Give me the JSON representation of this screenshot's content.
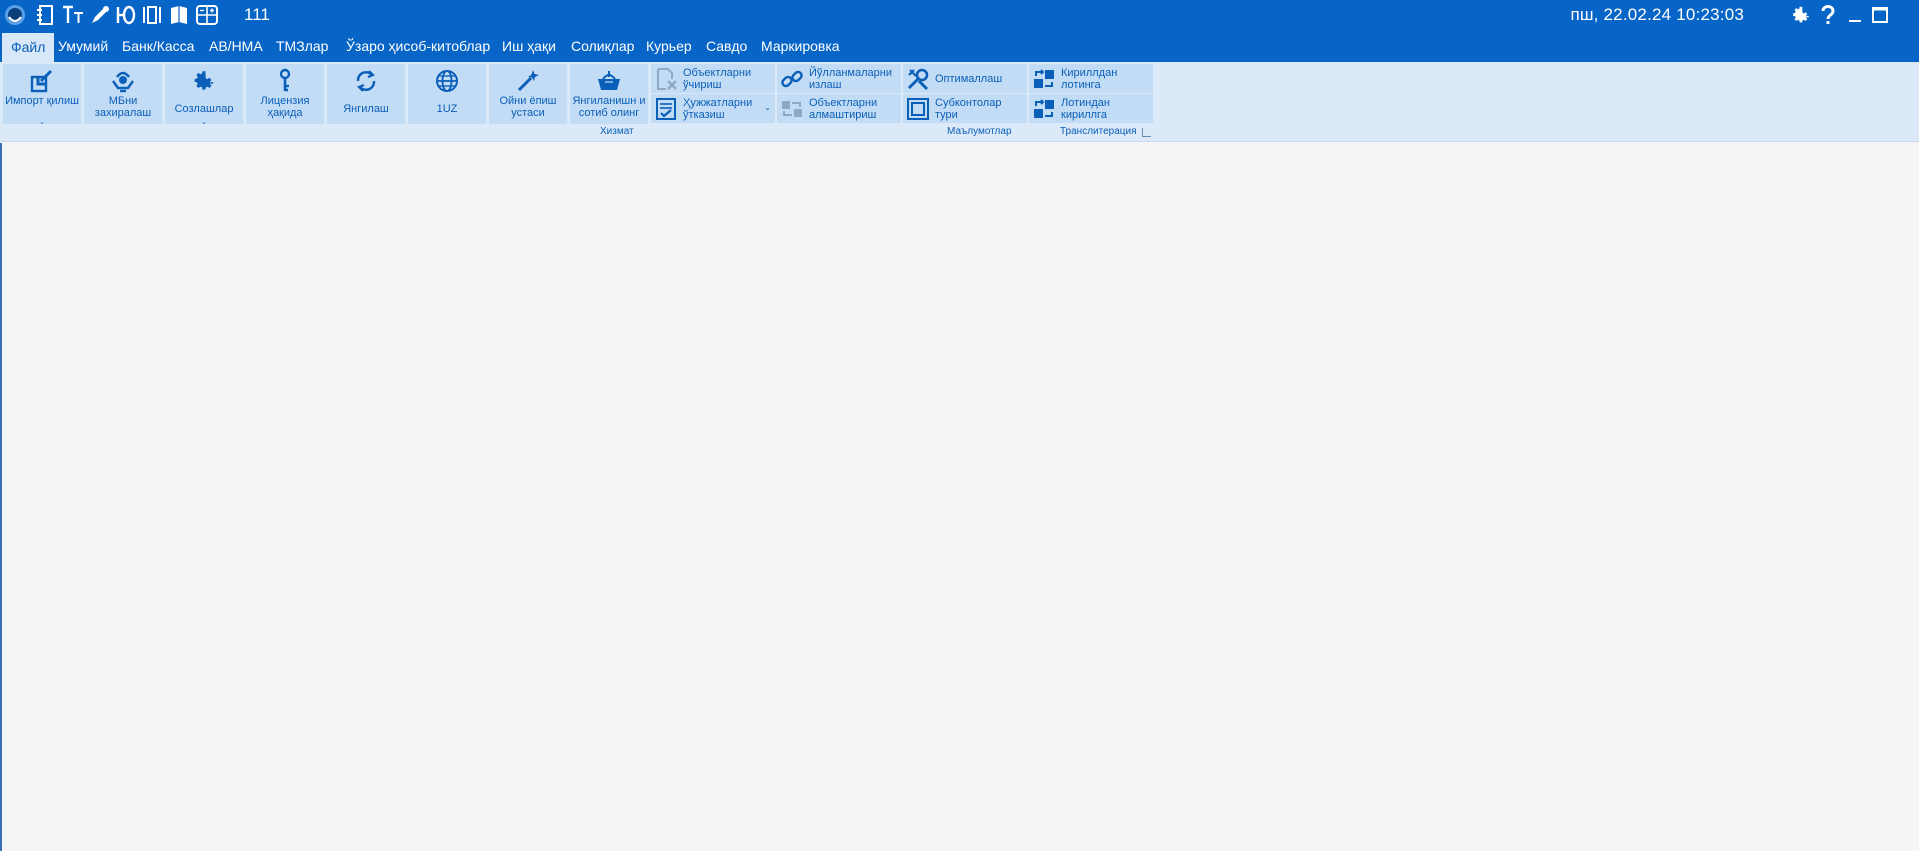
{
  "titlebar": {
    "doc_number": "111",
    "datetime": "пш, 22.02.24 10:23:03",
    "quick_access_icons": [
      "app-logo-icon",
      "notebook-icon",
      "text-size-icon",
      "pen-icon",
      "currency-icon",
      "columns-icon",
      "book-icon",
      "calculator-icon"
    ],
    "window_buttons": [
      "settings-icon",
      "help-icon",
      "minimize-icon",
      "maximize-icon"
    ]
  },
  "menu": {
    "items": [
      "Файл",
      "Умумий",
      "Банк/Касса",
      "АВ/НМА",
      "ТМЗлар",
      "Ўзаро ҳисоб-китоблар",
      "Иш ҳақи",
      "Солиқлар",
      "Курьер",
      "Савдо",
      "Маркировка"
    ],
    "active": "Файл"
  },
  "ribbon": {
    "large_buttons": [
      {
        "label": "Импорт қилиш",
        "icon": "import-icon",
        "has_dropdown": true
      },
      {
        "label": "МБни захиралаш",
        "icon": "backup-icon",
        "has_dropdown": false
      },
      {
        "label": "Созлашлар",
        "icon": "settings-icon",
        "has_dropdown": true
      },
      {
        "label": "Лицензия ҳақида",
        "icon": "key-icon",
        "has_dropdown": false
      },
      {
        "label": "Янгилаш",
        "icon": "refresh-icon",
        "has_dropdown": false
      },
      {
        "label": "1UZ",
        "icon": "globe-icon",
        "has_dropdown": false
      },
      {
        "label": "Ойни ёпиш устаси",
        "icon": "magic-wand-icon",
        "has_dropdown": false
      },
      {
        "label": "Янгиланишн и сотиб олинг",
        "icon": "basket-icon",
        "has_dropdown": false
      }
    ],
    "small_buttons": {
      "delete_objects": "Объектларни ўчириш",
      "post_documents": "Ҳужжатларни ўтказиш",
      "search_postings": "Йўлланмаларни излаш",
      "replace_objects": "Объектларни алмаштириш",
      "optimize": "Оптималлаш",
      "subconto_types": "Субконтолар тури",
      "cyr_to_lat": "Кириллдан лотинга",
      "lat_to_cyr": "Лотиндан кириллга"
    },
    "groups": {
      "service": "Хизмат",
      "data": "Маълумотлар",
      "transliteration": "Транслитерация"
    }
  },
  "colors": {
    "title_bg": "#0865c8",
    "ribbon_bg": "#dbe9f8",
    "tile_bg": "#c3dcf6",
    "accent": "#0a5fb8",
    "workspace": "#f5f5f5"
  }
}
